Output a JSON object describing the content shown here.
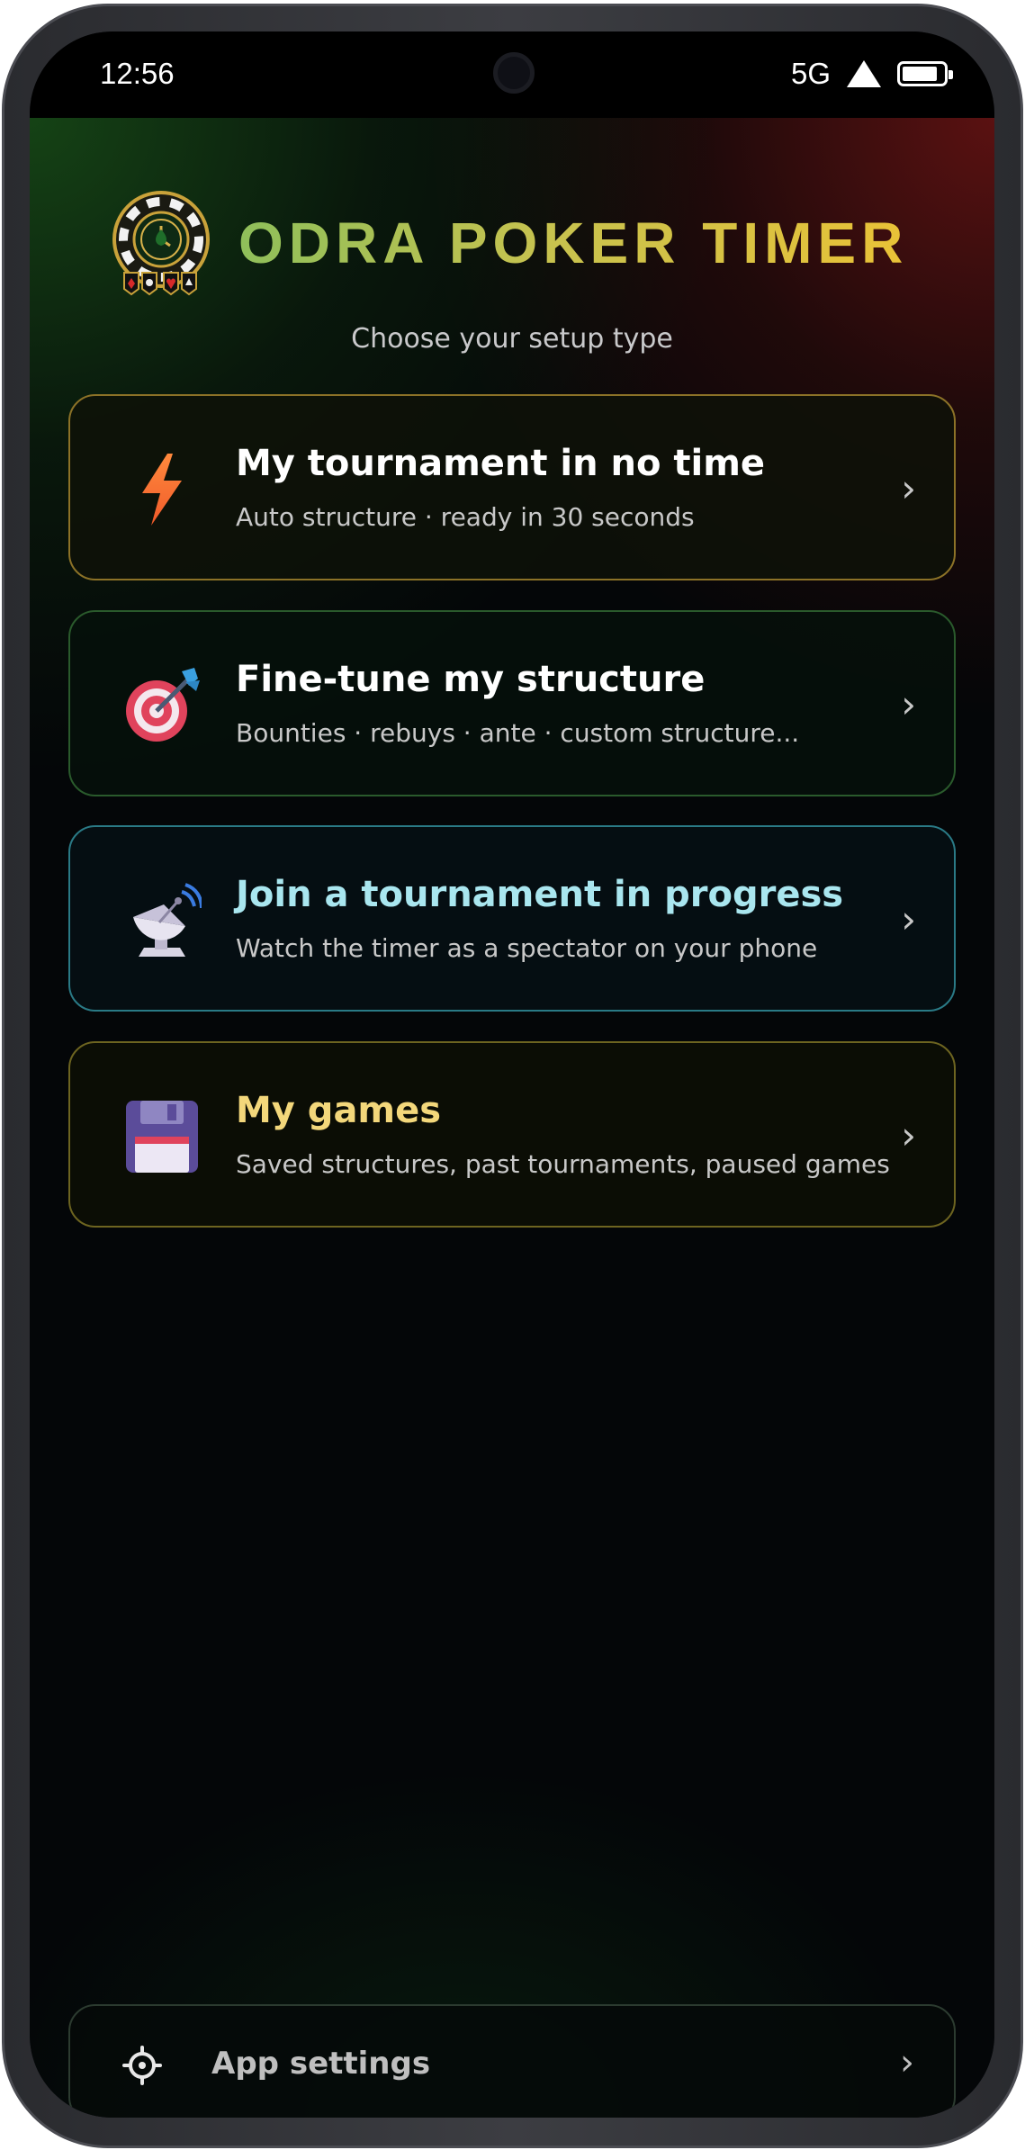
{
  "status_bar": {
    "time": "12:56",
    "network": "5G"
  },
  "header": {
    "app_title": "ODRA POKER TIMER",
    "subtitle": "Choose your setup type"
  },
  "options": [
    {
      "title": "My tournament in no time",
      "description": "Auto structure · ready in 30 seconds",
      "icon": "lightning-icon",
      "chevron": "›"
    },
    {
      "title": "Fine-tune my structure",
      "description": "Bounties · rebuys · ante · custom structure...",
      "icon": "target-icon",
      "chevron": "›"
    },
    {
      "title": "Join a tournament in progress",
      "description": "Watch the timer as a spectator on your phone",
      "icon": "satellite-dish-icon",
      "chevron": "›"
    },
    {
      "title": "My games",
      "description": "Saved structures, past tournaments, paused games",
      "icon": "floppy-disk-icon",
      "chevron": "›"
    }
  ],
  "settings": {
    "label": "App settings",
    "icon": "gear-icon",
    "chevron": "›"
  },
  "colors": {
    "title_gradient_start": "#8fbf5a",
    "title_gradient_end": "#e9c237",
    "join_title": "#a9e6ef",
    "games_title": "#f3d77b"
  }
}
